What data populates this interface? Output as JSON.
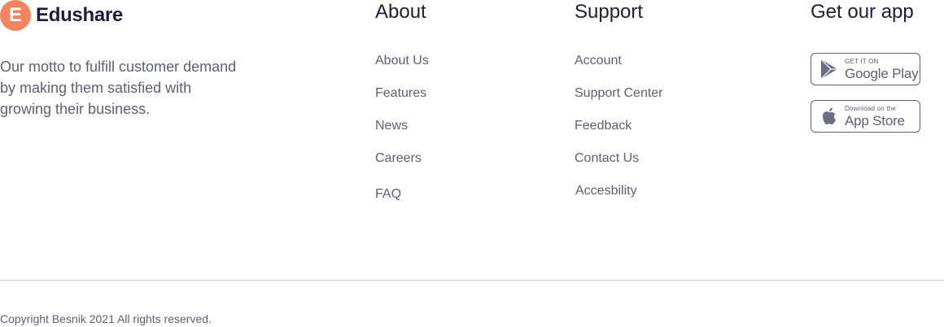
{
  "brand": {
    "mark": "E",
    "name": "Edushare",
    "accent": "#f4845f",
    "motto": "Our motto to fulfill customer demand by making them satisfied with growing their business."
  },
  "about": {
    "title": "About",
    "links": [
      "About Us",
      "Features",
      "News",
      "Careers",
      "FAQ"
    ]
  },
  "support": {
    "title": "Support",
    "links": [
      "Account",
      "Support Center",
      "Feedback",
      "Contact Us",
      "Accesbility"
    ]
  },
  "app": {
    "title": "Get our app",
    "google_play": {
      "small": "GET IT ON",
      "big": "Google Play",
      "icon": "google-play-icon"
    },
    "app_store": {
      "small": "Download on the",
      "big": "App Store",
      "icon": "apple-icon"
    }
  },
  "copyright": "Copyright Besnik 2021 All rights reserved."
}
